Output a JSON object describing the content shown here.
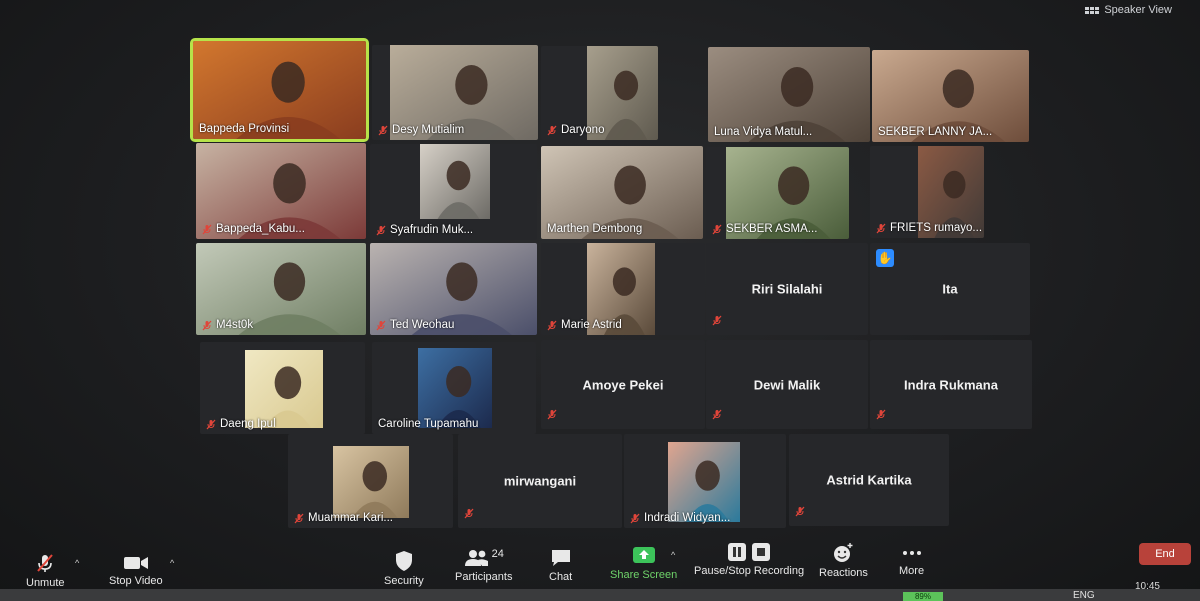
{
  "header": {
    "view_toggle": "Speaker View"
  },
  "participants": [
    {
      "name": "Bappeda Provinsi",
      "video": true,
      "muted": false,
      "active": true
    },
    {
      "name": "Desy Mutialim",
      "video": true,
      "muted": true
    },
    {
      "name": "Daryono",
      "video": true,
      "muted": true
    },
    {
      "name": "Luna Vidya Matul...",
      "video": true,
      "muted": false
    },
    {
      "name": "SEKBER LANNY JA...",
      "video": true,
      "muted": false
    },
    {
      "name": "Bappeda_Kabu...",
      "video": true,
      "muted": true
    },
    {
      "name": "Syafrudin Muk...",
      "video": true,
      "muted": true
    },
    {
      "name": "Marthen Dembong",
      "video": true,
      "muted": false
    },
    {
      "name": "SEKBER ASMA...",
      "video": true,
      "muted": true
    },
    {
      "name": "FRIETS rumayo...",
      "video": true,
      "muted": true
    },
    {
      "name": "M4st0k",
      "video": true,
      "muted": true
    },
    {
      "name": "Ted Weohau",
      "video": true,
      "muted": true
    },
    {
      "name": "Marie Astrid",
      "video": true,
      "muted": true
    },
    {
      "name": "Riri Silalahi",
      "video": false,
      "muted": true
    },
    {
      "name": "Ita",
      "video": false,
      "muted": false,
      "hand_raised": true
    },
    {
      "name": "Daeng Ipul",
      "video": true,
      "muted": true
    },
    {
      "name": "Caroline Tupamahu",
      "video": true,
      "muted": false
    },
    {
      "name": "Amoye Pekei",
      "video": false,
      "muted": true
    },
    {
      "name": "Dewi Malik",
      "video": false,
      "muted": true
    },
    {
      "name": "Indra Rukmana",
      "video": false,
      "muted": true
    },
    {
      "name": "Muammar Kari...",
      "video": true,
      "muted": true
    },
    {
      "name": "mirwangani",
      "video": false,
      "muted": true
    },
    {
      "name": "Indradi Widyan...",
      "video": true,
      "muted": true
    },
    {
      "name": "Astrid Kartika",
      "video": false,
      "muted": true
    }
  ],
  "toolbar": {
    "unmute": "Unmute",
    "stop_video": "Stop Video",
    "security": "Security",
    "participants": "Participants",
    "participants_count": "24",
    "chat": "Chat",
    "share_screen": "Share Screen",
    "recording": "Pause/Stop Recording",
    "reactions": "Reactions",
    "more": "More",
    "end": "End"
  },
  "taskbar": {
    "battery": "89%",
    "language": "ENG",
    "time": "10:45"
  },
  "colors": {
    "active_speaker": "#b6e34a",
    "share_green": "#3cc35a",
    "end_red": "#b8423a",
    "mute_red": "#e0453a"
  }
}
